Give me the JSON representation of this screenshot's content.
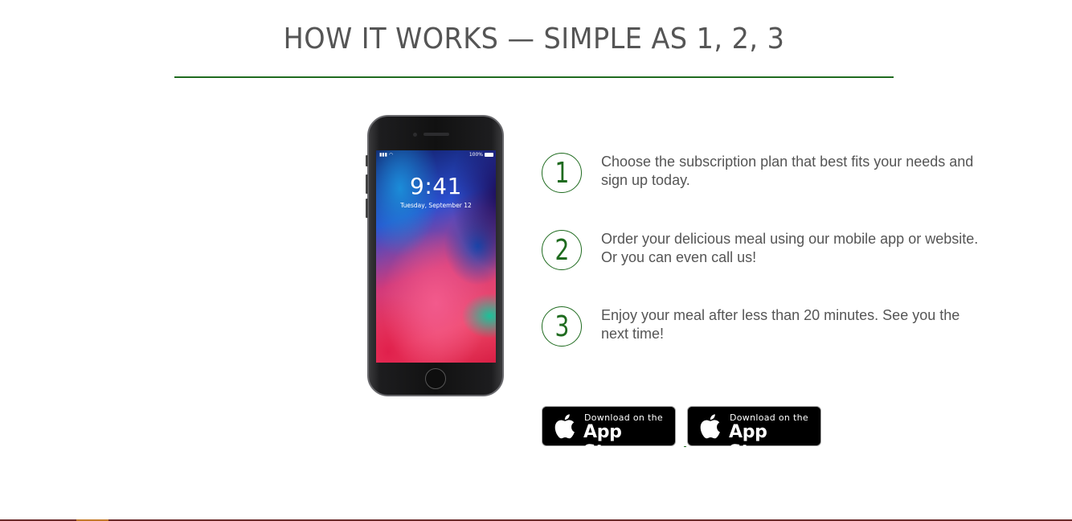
{
  "section": {
    "title": "HOW IT WORKS — SIMPLE AS 1, 2, 3"
  },
  "phone": {
    "time": "9:41",
    "date": "Tuesday, September 12",
    "battery": "100%"
  },
  "steps": [
    {
      "number": "1",
      "text": "Choose the subscription plan that best fits your needs and sign up today."
    },
    {
      "number": "2",
      "text": "Order your delicious meal using our mobile app or website. Or you can even call us!"
    },
    {
      "number": "3",
      "text": "Enjoy your meal after less than 20 minutes. See you the next time!"
    }
  ],
  "badges": [
    {
      "small": "Download on the",
      "big": "App Store"
    },
    {
      "small": "Download on the",
      "big": "App Store"
    }
  ],
  "colors": {
    "accent": "#1f6b1f",
    "text": "#555555",
    "footer": "#6b2a2a"
  },
  "icons": {
    "badge_logo": "apple-icon"
  }
}
